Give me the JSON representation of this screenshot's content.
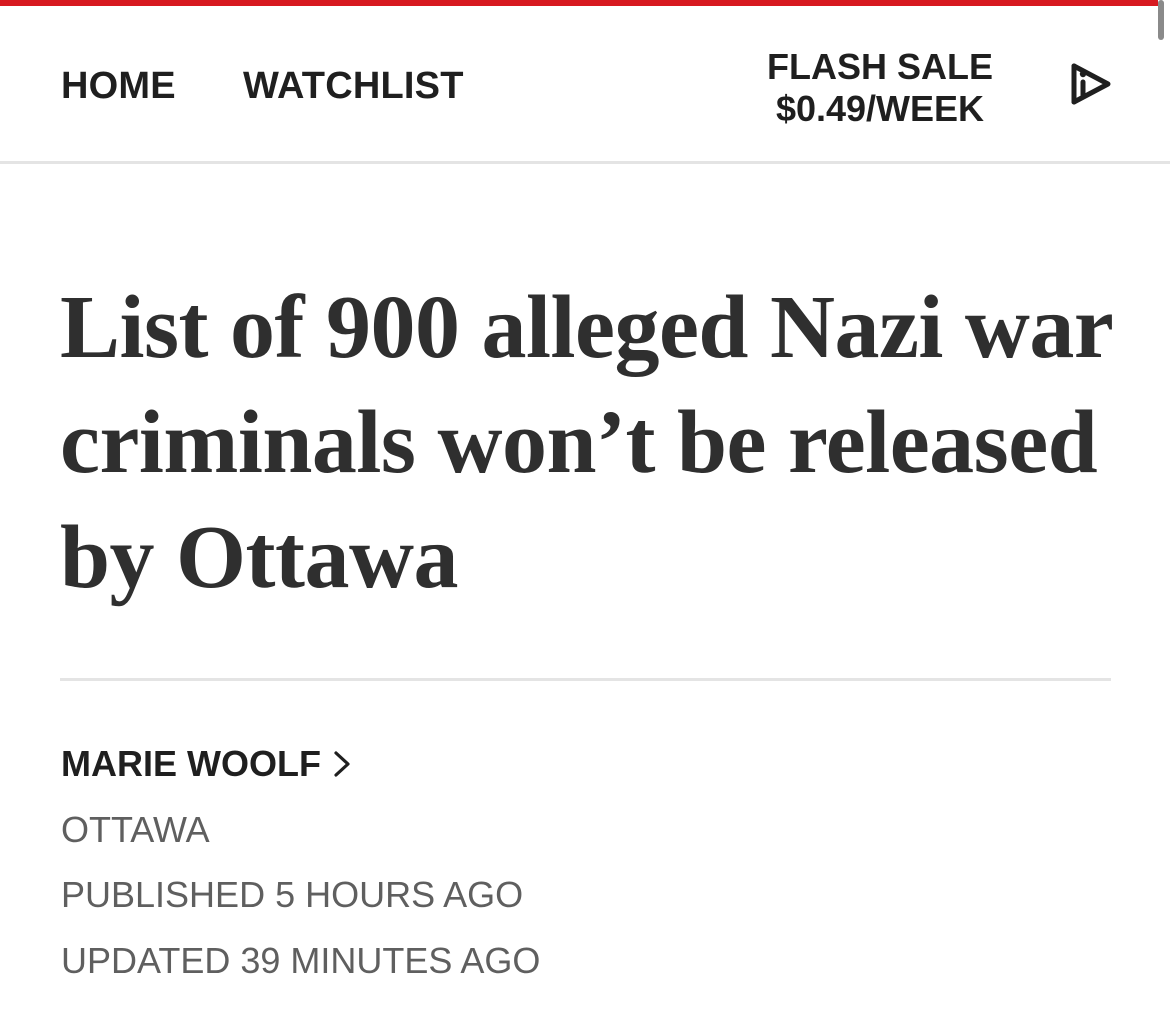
{
  "brand": {
    "accent_color": "#d71920"
  },
  "nav": {
    "home_label": "HOME",
    "watchlist_label": "WATCHLIST",
    "promo_line1": "FLASH SALE",
    "promo_line2": "$0.49/WEEK",
    "media_icon": "play-icon"
  },
  "article": {
    "headline": "List of 900 alleged Nazi war criminals won’t be released by Ottawa",
    "author": "MARIE WOOLF",
    "author_icon": "chevron-right-icon",
    "location": "OTTAWA",
    "published": "PUBLISHED 5 HOURS AGO",
    "updated": "UPDATED 39 MINUTES AGO"
  }
}
